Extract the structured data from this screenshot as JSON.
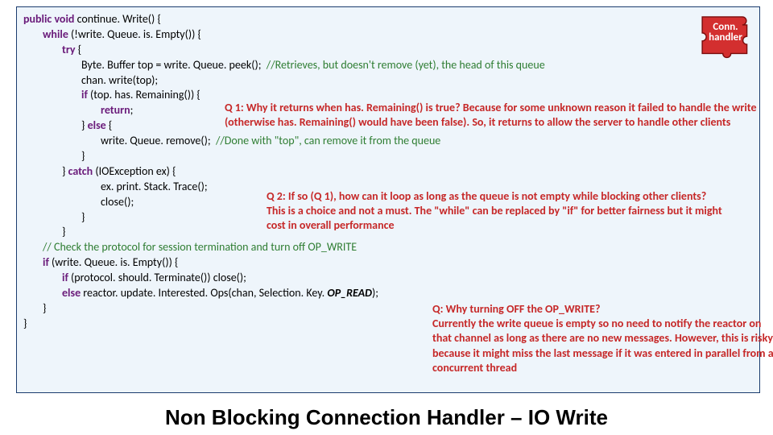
{
  "badge": {
    "line1": "Conn.",
    "line2": "handler"
  },
  "title": "Non Blocking Connection Handler – IO Write",
  "code": {
    "l1_kw": "public void ",
    "l1_rest": "continue. Write() {",
    "l2_kw": "while ",
    "l2_rest": "(!write. Queue. is. Empty()) {",
    "l3_kw": "try ",
    "l3_rest": "{",
    "l4a": "Byte. Buffer top = write. Queue. peek();  ",
    "l4c": "//Retrieves, but doesn't remove (yet), the head of this queue",
    "l5": "chan. write(top);",
    "l6_kw": "if ",
    "l6_rest": "(top. has. Remaining()) {",
    "l7_kw": "return",
    "l7_rest": ";",
    "l8a": "} ",
    "l8_kw": "else ",
    "l8b": "{",
    "l9a": "write. Queue. remove();  ",
    "l9c": "//Done with \"top\", can remove it from the queue",
    "l10": "}",
    "l11a": "} ",
    "l11_kw": "catch ",
    "l11b": "(IOException ex) {",
    "l12": "ex. print. Stack. Trace();",
    "l13": "close();",
    "l14": "}",
    "l15": "}",
    "l16": "// Check the protocol for session termination and turn off OP_WRITE",
    "l17_kw": "if ",
    "l17_rest": "(write. Queue. is. Empty()) {",
    "l18_kw": "if ",
    "l18_rest": "(protocol. should. Terminate()) close();",
    "l19_kw": "else ",
    "l19_rest1": "reactor. update. Interested. Ops(chan, Selection. Key. ",
    "l19_em": "OP_READ",
    "l19_rest2": ");",
    "l20": "}",
    "l21": "}"
  },
  "annotations": {
    "a1_q": "Q 1: Why it returns when has. Remaining() is true? ",
    "a1_ans": "Because for some unknown reason it failed to handle the write (otherwise has. Remaining() would have been false). So, it returns to allow the server to handle other clients",
    "a2_q": "Q 2: If so (Q 1), how can it loop as long as the queue is not empty while blocking other clients?",
    "a2_ans": "This is a choice and not a must. The \"while\" can be replaced by \"if\" for better fairness but it might cost in overall performance",
    "a3_q": "Q: Why turning OFF the OP_WRITE?",
    "a3_ans": "Currently the write queue is empty so no need to notify the reactor on that channel as  long as there are no new messages. However, this is risky because it might miss the last message if it was entered in parallel from a concurrent thread"
  }
}
